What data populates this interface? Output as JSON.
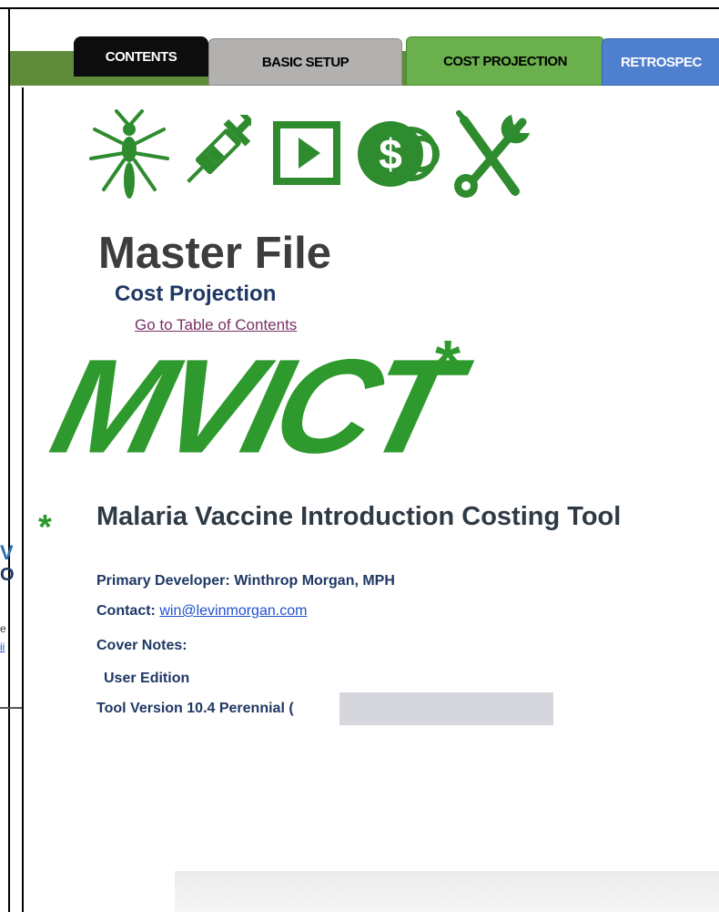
{
  "tabs": {
    "contents": "CONTENTS",
    "basic_setup": "BASIC SETUP",
    "cost_projection": "COST PROJECTION",
    "retrospective": "RETROSPEC"
  },
  "icons": [
    "mosquito-icon",
    "syringe-icon",
    "play-icon",
    "dollar-coins-icon",
    "tools-icon"
  ],
  "header": {
    "title": "Master File",
    "subtitle": "Cost  Projection",
    "toc_link": "Go to Table of Contents"
  },
  "logo": {
    "text": "MVICT",
    "asterisk": "*"
  },
  "tool": {
    "asterisk": "*",
    "name": "Malaria Vaccine Introduction Costing Tool"
  },
  "info": {
    "developer_label": "Primary Developer:",
    "developer_value": "Winthrop Morgan, MPH",
    "contact_label": "Contact:",
    "contact_email": "win@levinmorgan.com",
    "cover_notes": "Cover Notes:",
    "edition": "User Edition",
    "version": "Tool Version 10.4 Perennial ("
  },
  "side_fragments": {
    "w": "V",
    "o": "O",
    "e": "e",
    "link": "ii"
  },
  "colors": {
    "green": "#2e9a2e",
    "navy": "#1f3864",
    "tab_green": "#6ab04c",
    "tab_blue": "#4f7fcf"
  }
}
